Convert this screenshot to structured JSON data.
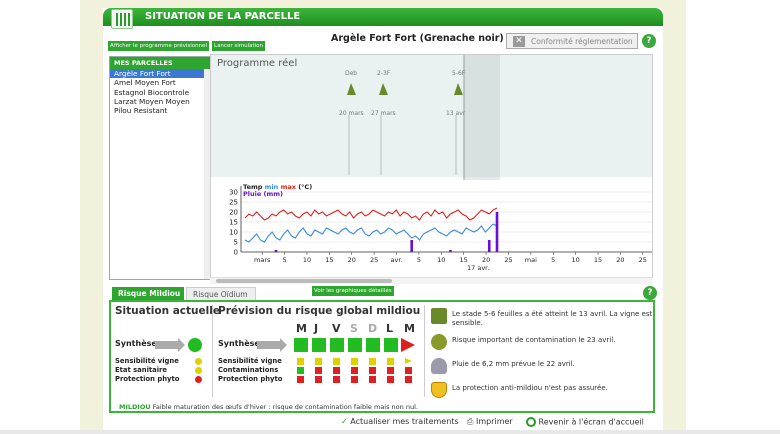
{
  "header": {
    "title": "SITUATION DE LA PARCELLE"
  },
  "buttons": {
    "afficher": "Afficher le programme prévisionnel",
    "lancer": "Lancer simulation",
    "conformite": "Conformité réglementation",
    "graphiques": "Voir les graphiques détaillés"
  },
  "plot_title": "Argèle Fort Fort (Grenache noir)",
  "parcelles": {
    "heading": "MES PARCELLES",
    "items": [
      "Argèle Fort Fort",
      "Amel Moyen Fort",
      "Estagnol Biocontrole",
      "Larzat Moyen Moyen",
      "Pilou Resistant"
    ],
    "selected": 0
  },
  "programme": {
    "label": "Programme réel",
    "stages": [
      {
        "code": "Deb",
        "date": "20 mars"
      },
      {
        "code": "2-3F",
        "date": "27 mars"
      },
      {
        "code": "5-6F",
        "date": "13 avr"
      }
    ],
    "legend_temp": "Temp",
    "legend_min": "min",
    "legend_max": "max",
    "legend_unit": "(°C)",
    "legend_pluie": "Pluie (mm)",
    "current_date": "17 avr."
  },
  "chart_data": {
    "type": "line",
    "y_ticks": [
      "0",
      "5",
      "10",
      "15",
      "20",
      "25",
      "30"
    ],
    "ylim": [
      0,
      30
    ],
    "x_ticks": [
      "mars",
      "5",
      "10",
      "15",
      "20",
      "25",
      "avr.",
      "5",
      "10",
      "15",
      "20",
      "25",
      "mai",
      "5",
      "10",
      "15",
      "20",
      "25"
    ],
    "series": [
      {
        "name": "max",
        "color": "#e02020",
        "values": [
          17,
          19,
          18,
          20,
          18,
          16,
          17,
          19,
          18,
          20,
          21,
          19,
          20,
          18,
          17,
          19,
          20,
          18,
          21,
          19,
          20,
          18,
          19,
          20,
          21,
          19,
          18,
          20,
          17,
          19,
          20,
          18,
          19,
          21,
          20,
          19,
          18,
          20,
          19,
          21,
          18,
          20,
          19,
          17,
          18,
          16,
          19,
          20,
          18,
          21,
          19,
          20,
          17,
          19,
          20,
          21,
          19,
          18,
          16,
          17,
          19,
          21,
          20,
          19,
          21,
          22
        ]
      },
      {
        "name": "min",
        "color": "#3a8ae0",
        "values": [
          6,
          5,
          7,
          9,
          6,
          5,
          8,
          10,
          7,
          6,
          9,
          11,
          8,
          7,
          10,
          12,
          9,
          8,
          11,
          10,
          9,
          12,
          11,
          10,
          9,
          11,
          12,
          10,
          9,
          11,
          12,
          9,
          8,
          10,
          11,
          9,
          10,
          12,
          11,
          9,
          10,
          11,
          9,
          7,
          8,
          6,
          9,
          10,
          11,
          12,
          10,
          9,
          8,
          10,
          11,
          10,
          9,
          12,
          11,
          10,
          11,
          13,
          10,
          12,
          14,
          13
        ]
      },
      {
        "name": "Pluie (mm)",
        "color": "#6a0fcf",
        "values": [
          0,
          0,
          0,
          0,
          0,
          0,
          0,
          0,
          1,
          0,
          0,
          0,
          0,
          0,
          0,
          0,
          0,
          0,
          0,
          0,
          0,
          0,
          0,
          0,
          0,
          0,
          0,
          0,
          0,
          0,
          0,
          0,
          0,
          0,
          0,
          0,
          0,
          0,
          0,
          0,
          0,
          0,
          0,
          6,
          0,
          0,
          0,
          0,
          0,
          0,
          0,
          0,
          0,
          1,
          0,
          0,
          0,
          0,
          0,
          0,
          0,
          0,
          0,
          6,
          0,
          20
        ]
      }
    ]
  },
  "tabs": [
    {
      "label": "Risque Mildiou",
      "active": true
    },
    {
      "label": "Risque Oïdium",
      "active": false
    }
  ],
  "situation": {
    "title": "Situation actuelle",
    "synthese": "Synthèse",
    "rows": [
      "Sensibilité vigne",
      "Etat sanitaire",
      "Protection phyto"
    ],
    "dot_colors": [
      "#e0d000",
      "#e0d000",
      "#e02020"
    ],
    "synth_color": "#22bb22"
  },
  "prevision": {
    "title": "Prévision du risque global mildiou",
    "days": [
      "M",
      "J",
      "V",
      "S",
      "D",
      "L",
      "M"
    ],
    "gray_days": [
      3,
      4
    ],
    "synthese": "Synthèse",
    "rows": [
      "Sensibilité vigne",
      "Contaminations",
      "Protection phyto"
    ],
    "row_colors": [
      [
        "#e0d000",
        "#e0d000",
        "#e0d000",
        "#e0d000",
        "#e0d000",
        "#e0d000",
        "#e0d000"
      ],
      [
        "#22bb22",
        "#e02020",
        "#e02020",
        "#e02020",
        "#e02020",
        "#e02020",
        "#e02020"
      ],
      [
        "#e02020",
        "#e02020",
        "#e02020",
        "#e02020",
        "#e02020",
        "#e02020",
        "#e02020"
      ]
    ],
    "synth_color": "#22bb22",
    "synth_last": "#e02020"
  },
  "notes": [
    {
      "icon": "vine-stage-icon",
      "text": "Le stade 5-6 feuilles a été atteint le 13 avril. La vigne est sensible."
    },
    {
      "icon": "contamination-icon",
      "text": "Risque important de contamination le 23 avril."
    },
    {
      "icon": "rain-cloud-icon",
      "text": "Pluie de 6,2 mm prévue le 22 avril."
    },
    {
      "icon": "shield-icon",
      "text": "La protection anti-mildiou n'est pas assurée."
    }
  ],
  "footer_note": {
    "prefix": "MILDIOU",
    "text": "Faible maturation des œufs d'hiver : risque de contamination faible mais non nul."
  },
  "actions": {
    "actualiser": "Actualiser mes traitements",
    "imprimer": "Imprimer",
    "revenir": "Revenir à l'écran d'accueil"
  }
}
